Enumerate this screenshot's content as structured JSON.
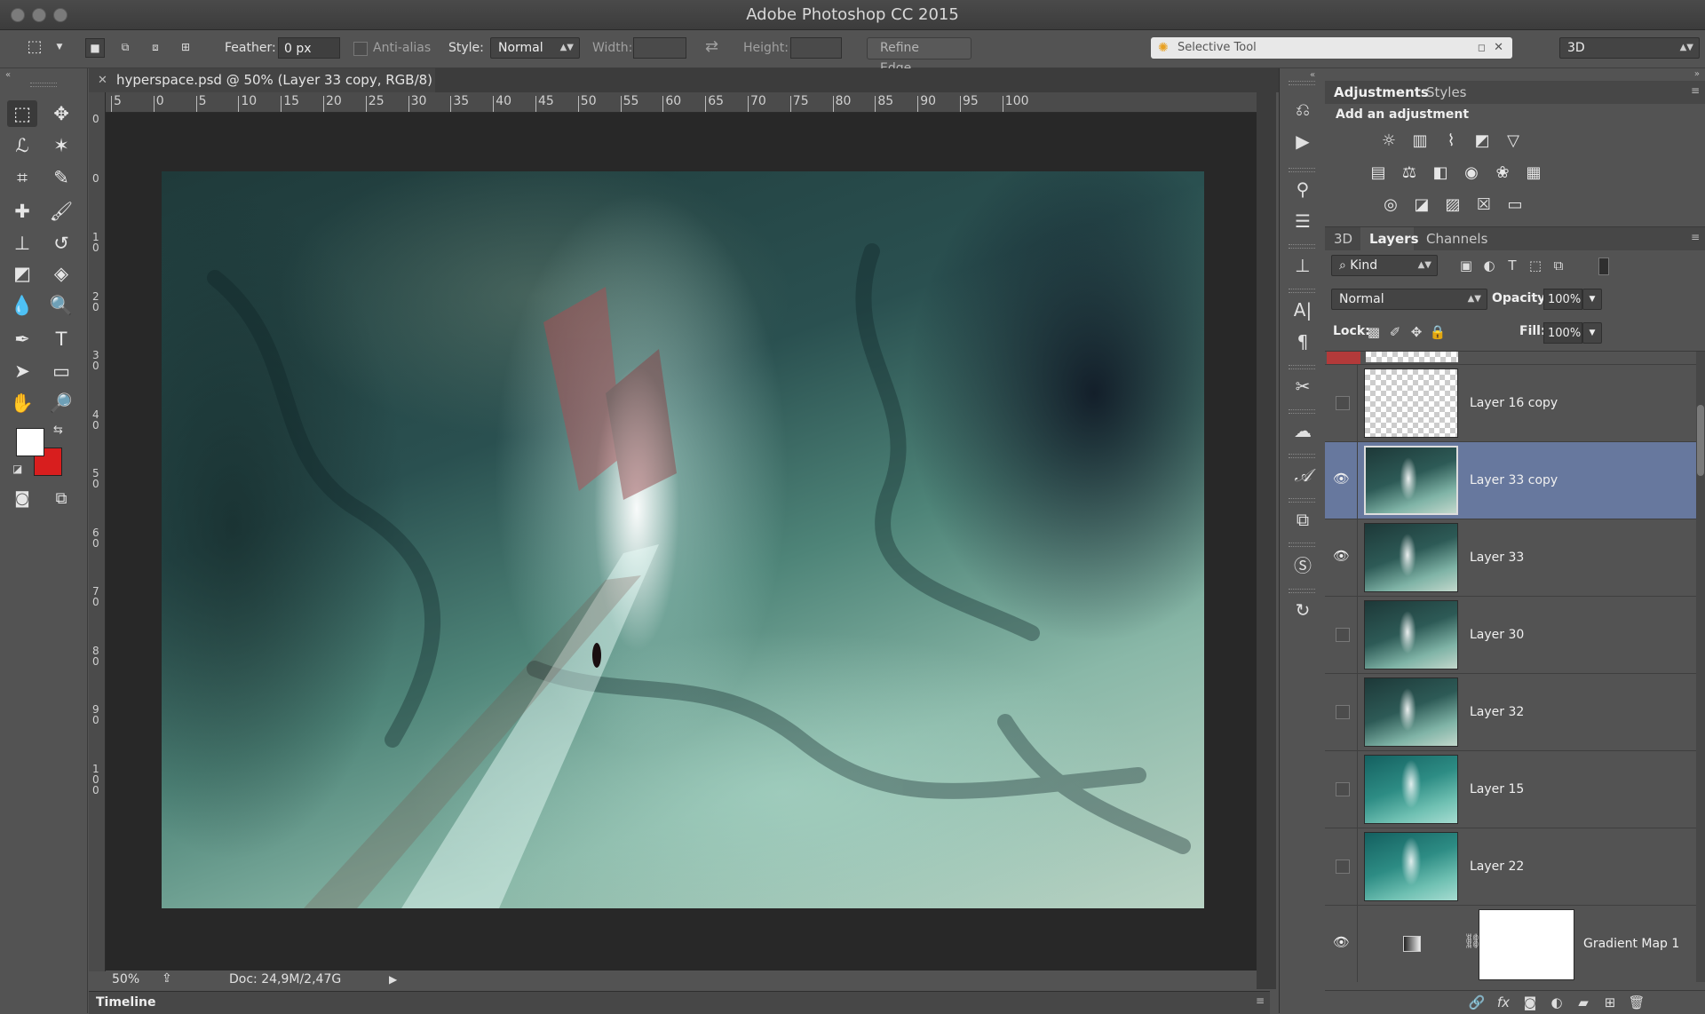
{
  "app": {
    "title": "Adobe Photoshop CC 2015"
  },
  "options_bar": {
    "feather_label": "Feather:",
    "feather_value": "0 px",
    "anti_alias_label": "Anti-alias",
    "style_label": "Style:",
    "style_value": "Normal",
    "width_label": "Width:",
    "height_label": "Height:",
    "refine_edge_label": "Refine Edge...",
    "workspace_value": "3D"
  },
  "search_panel": {
    "label": "Selective Tool"
  },
  "document": {
    "tab_title": "hyperspace.psd @ 50% (Layer 33 copy, RGB/8)",
    "zoom": "50%",
    "doc_info": "Doc: 24,9M/2,47G"
  },
  "rulers": {
    "horizontal": [
      "5",
      "0",
      "5",
      "10",
      "15",
      "20",
      "25",
      "30",
      "35",
      "40",
      "45",
      "50",
      "55",
      "60",
      "65",
      "70",
      "75",
      "80",
      "85",
      "90",
      "95",
      "100"
    ],
    "vertical": [
      "0",
      "0",
      "1\n0",
      "2\n0",
      "3\n0",
      "4\n0",
      "5\n0",
      "6\n0",
      "7\n0",
      "8\n0",
      "9\n0",
      "1\n0\n0"
    ]
  },
  "timeline": {
    "label": "Timeline"
  },
  "colors": {
    "foreground": "#ffffff",
    "background": "#d81e1e",
    "selected_layer": "#67789e"
  },
  "adjustments_panel": {
    "tabs": [
      "Adjustments",
      "Styles"
    ],
    "heading": "Add an adjustment"
  },
  "layers_panel": {
    "tabs": [
      "3D",
      "Layers",
      "Channels"
    ],
    "filter_kind": "Kind",
    "blend_mode": "Normal",
    "opacity_label": "Opacity:",
    "opacity_value": "100%",
    "lock_label": "Lock:",
    "fill_label": "Fill:",
    "fill_value": "100%",
    "layers": [
      {
        "name": "Layer 16 copy",
        "visible": false,
        "selected": false
      },
      {
        "name": "Layer 33 copy",
        "visible": true,
        "selected": true
      },
      {
        "name": "Layer 33",
        "visible": true,
        "selected": false
      },
      {
        "name": "Layer 30",
        "visible": false,
        "selected": false
      },
      {
        "name": "Layer 32",
        "visible": false,
        "selected": false
      },
      {
        "name": "Layer 15",
        "visible": false,
        "selected": false
      },
      {
        "name": "Layer 22",
        "visible": false,
        "selected": false
      },
      {
        "name": "Gradient Map 1",
        "visible": true,
        "selected": false
      }
    ]
  }
}
